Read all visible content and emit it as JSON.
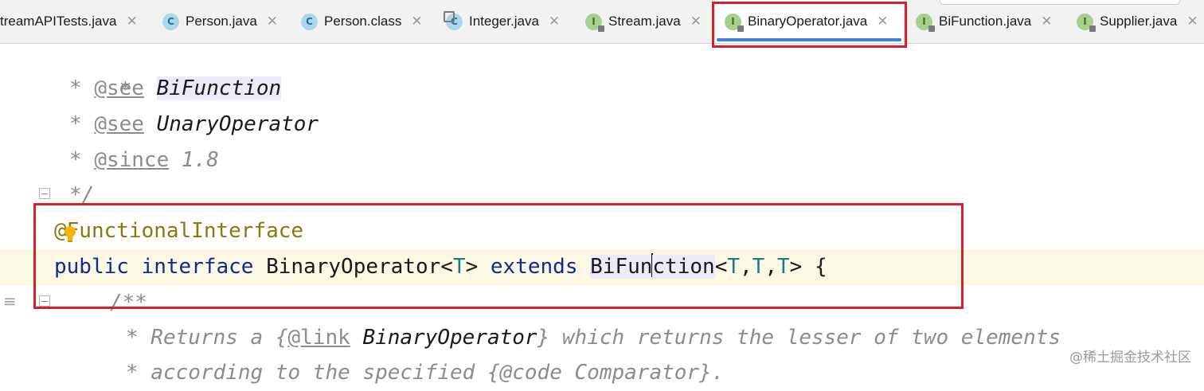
{
  "tabs": [
    {
      "label": "treamAPITests.java",
      "icon": "java-class-icon",
      "kind": "none"
    },
    {
      "label": "Person.java",
      "icon": "class-icon",
      "kind": "c"
    },
    {
      "label": "Person.class",
      "icon": "class-icon",
      "kind": "c"
    },
    {
      "label": "Integer.java",
      "icon": "class-icon",
      "kind": "cl"
    },
    {
      "label": "Stream.java",
      "icon": "interface-icon",
      "kind": "i"
    },
    {
      "label": "BinaryOperator.java",
      "icon": "interface-icon",
      "kind": "i",
      "active": true
    },
    {
      "label": "BiFunction.java",
      "icon": "interface-icon",
      "kind": "i"
    },
    {
      "label": "Supplier.java",
      "icon": "interface-icon",
      "kind": "i"
    }
  ],
  "tab_icon_letters": {
    "c": "C",
    "i": "I"
  },
  "close_glyph": "✕",
  "code": {
    "l1": "*",
    "l2_star": "* ",
    "l2_tag": "@see",
    "l2_ref": "BiFunction",
    "l3_star": "* ",
    "l3_tag": "@see",
    "l3_ref": "UnaryOperator",
    "l4_star": "* ",
    "l4_tag": "@since",
    "l4_val": " 1.8",
    "l5": "*/",
    "l6": "@FunctionalInterface",
    "l7_public": "public",
    "l7_interface": "interface",
    "l7_name": "BinaryOperator",
    "l7_lt": "<",
    "l7_t": "T",
    "l7_gt": ">",
    "l7_extends": "extends",
    "l7_bifun_a": "BiFun",
    "l7_bifun_b": "ction",
    "l7_lt2": "<",
    "l7_t1": "T",
    "l7_comma1": ",",
    "l7_t2": "T",
    "l7_comma2": ",",
    "l7_t3": "T",
    "l7_tail": "> {",
    "l8": "/**",
    "l9_a": "* Returns a {",
    "l9_tag": "@link",
    "l9_ref": "BinaryOperator",
    "l9_b": "} which returns the lesser of two elements",
    "l10": "* according to the specified {@code Comparator}."
  },
  "watermark": "@稀土掘金技术社区",
  "colors": {
    "highlight_box": "#d9202a",
    "active_tab_bar": "#3f7fd4"
  }
}
